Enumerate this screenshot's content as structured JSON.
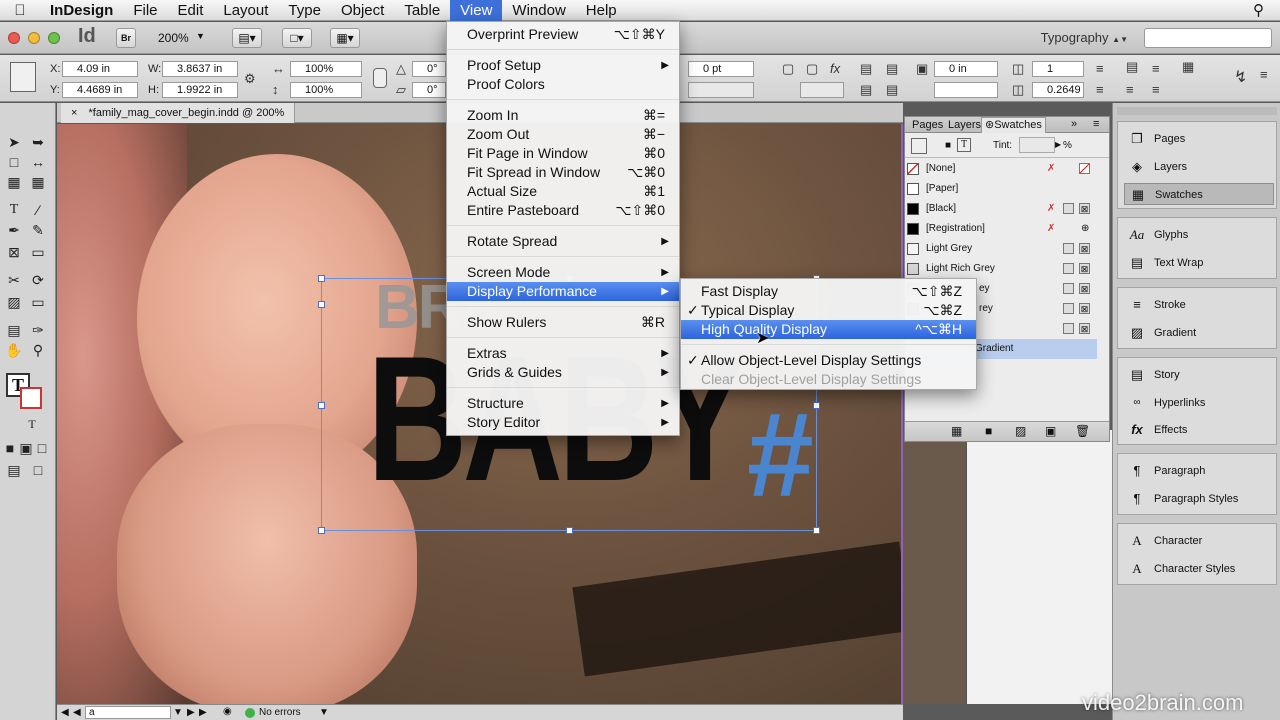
{
  "menubar": {
    "app": "InDesign",
    "items": [
      "File",
      "Edit",
      "Layout",
      "Type",
      "Object",
      "Table",
      "View",
      "Window",
      "Help"
    ],
    "active": "View"
  },
  "titlebar": {
    "logo": "Id",
    "bridge": "Br",
    "zoom": "200%",
    "workspace": "Typography"
  },
  "control": {
    "x_label": "X:",
    "x_value": "4.09 in",
    "y_label": "Y:",
    "y_value": "4.4689 in",
    "w_label": "W:",
    "w_value": "3.8637 in",
    "h_label": "H:",
    "h_value": "1.9922 in",
    "scale_x": "100%",
    "scale_y": "100%",
    "rotate": "0°",
    "shear": "0°",
    "stroke_weight": "0 pt",
    "inset": "0 in",
    "columns": "1",
    "gutter": "0.2649"
  },
  "document": {
    "tab_title": "*family_mag_cover_begin.indd @ 200%",
    "headline_top": "BRE",
    "headline_main": "BABY",
    "headline_symbol": "#"
  },
  "status": {
    "page": "a",
    "preflight": "No errors"
  },
  "swatches_panel": {
    "tabs": [
      "Pages",
      "Layers",
      "Swatches"
    ],
    "tint_label": "Tint:",
    "tint_unit": "%",
    "rows": [
      {
        "name": "[None]",
        "color": "#ffffff"
      },
      {
        "name": "[Paper]",
        "color": "#ffffff"
      },
      {
        "name": "[Black]",
        "color": "#000000"
      },
      {
        "name": "[Registration]",
        "color": "#000000"
      },
      {
        "name": "Light Grey",
        "color": "#e8e8e8"
      },
      {
        "name": "Light Rich Grey",
        "color": "#d6d6d6"
      },
      {
        "name": "ey",
        "color": "#c2c2c2"
      },
      {
        "name": "rey",
        "color": "#aaaaaa"
      },
      {
        "name": "",
        "color": "#888888"
      },
      {
        "name": "Gradient",
        "color": "#9ab8e6"
      }
    ]
  },
  "dock": {
    "groups": [
      [
        "Pages",
        "Layers",
        "Swatches"
      ],
      [
        "Glyphs",
        "Text Wrap"
      ],
      [
        "Stroke",
        "Gradient"
      ],
      [
        "Story",
        "Hyperlinks",
        "Effects"
      ],
      [
        "Paragraph",
        "Paragraph Styles"
      ],
      [
        "Character",
        "Character Styles"
      ]
    ]
  },
  "view_menu": {
    "items": [
      {
        "label": "Overprint Preview",
        "shortcut": "⌥⇧⌘Y"
      },
      {
        "label": "Proof Setup",
        "submenu": true
      },
      {
        "label": "Proof Colors"
      },
      {
        "label": "Zoom In",
        "shortcut": "⌘="
      },
      {
        "label": "Zoom Out",
        "shortcut": "⌘−"
      },
      {
        "label": "Fit Page in Window",
        "shortcut": "⌘0"
      },
      {
        "label": "Fit Spread in Window",
        "shortcut": "⌥⌘0"
      },
      {
        "label": "Actual Size",
        "shortcut": "⌘1"
      },
      {
        "label": "Entire Pasteboard",
        "shortcut": "⌥⇧⌘0"
      },
      {
        "label": "Rotate Spread",
        "submenu": true
      },
      {
        "label": "Screen Mode",
        "submenu": true
      },
      {
        "label": "Display Performance",
        "submenu": true
      },
      {
        "label": "Show Rulers",
        "shortcut": "⌘R"
      },
      {
        "label": "Extras",
        "submenu": true
      },
      {
        "label": "Grids & Guides",
        "submenu": true
      },
      {
        "label": "Structure",
        "submenu": true
      },
      {
        "label": "Story Editor",
        "submenu": true
      }
    ]
  },
  "display_submenu": {
    "items": [
      {
        "label": "Fast Display",
        "shortcut": "⌥⇧⌘Z"
      },
      {
        "label": "Typical Display",
        "shortcut": "⌥⌘Z",
        "checked": true
      },
      {
        "label": "High Quality Display",
        "shortcut": "^⌥⌘H"
      },
      {
        "label": "Allow Object-Level Display Settings",
        "checked": true
      },
      {
        "label": "Clear Object-Level Display Settings",
        "disabled": true
      }
    ]
  },
  "watermark": "video2brain.com",
  "colors": {
    "menu_highlight": "#2d64dc",
    "accent_blue": "#4a86d0",
    "frame_blue": "#6b8fd8"
  }
}
